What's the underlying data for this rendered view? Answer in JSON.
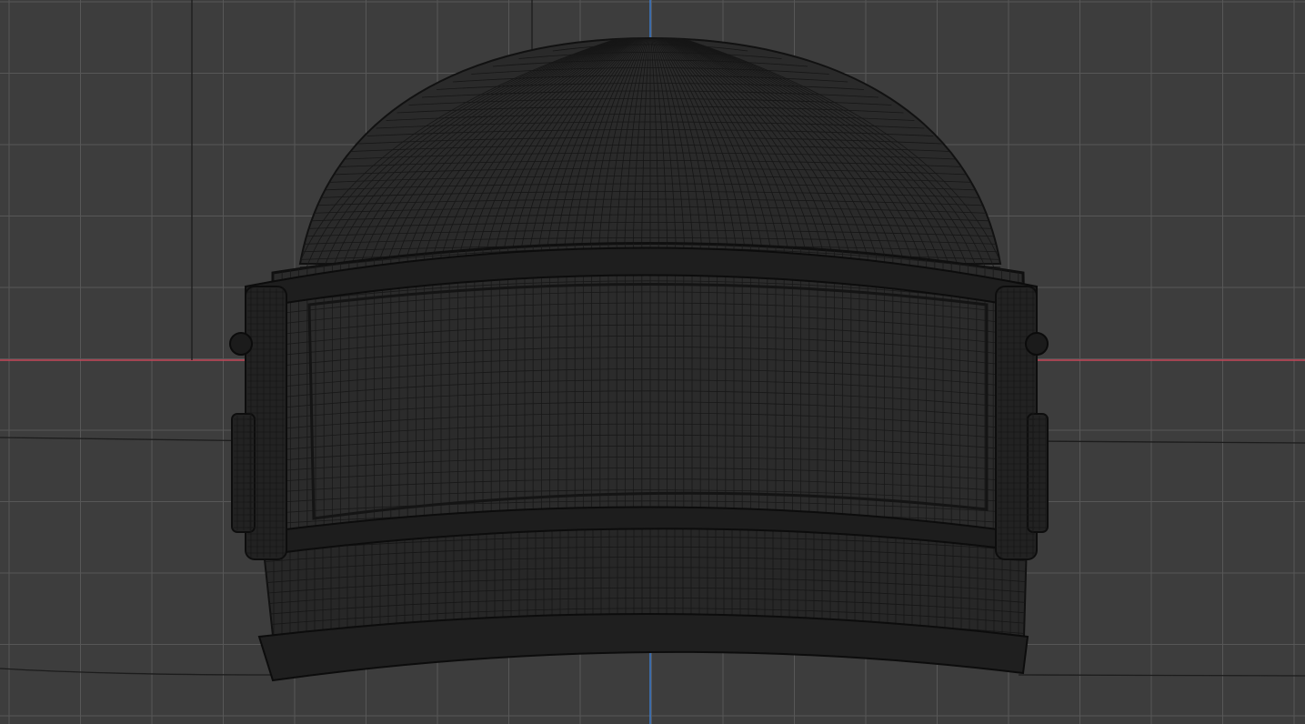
{
  "viewport": {
    "view": "front-orthographic",
    "shading": "wireframe",
    "object": "helmet-mesh",
    "grid": true,
    "colors": {
      "background": "#3d3d3d",
      "grid_line": "#575757",
      "x_axis": "#c6465a",
      "z_axis": "#3c7fd6",
      "wire": "#141414",
      "wire_fill": "#262626"
    }
  }
}
